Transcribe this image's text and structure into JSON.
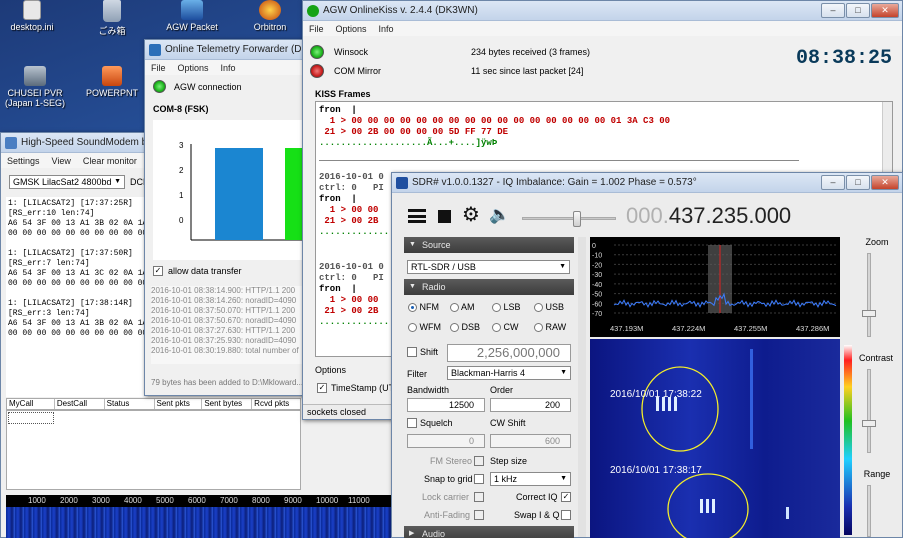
{
  "desktop": {
    "icons": [
      {
        "label": "desktop.ini",
        "icon": "file-icon"
      },
      {
        "label": "ごみ箱",
        "icon": "recycle-bin-icon"
      },
      {
        "label": "AGW Packet",
        "icon": "agw-icon"
      },
      {
        "label": "Orbitron",
        "icon": "orbitron-icon"
      },
      {
        "label": "CHUSEI PVR (Japan 1-SEG)",
        "icon": "tv-icon"
      },
      {
        "label": "POWERPNT",
        "icon": "powerpoint-icon"
      }
    ]
  },
  "soundmodem": {
    "title": "High-Speed SoundModem by...",
    "menu": [
      "Settings",
      "View",
      "Clear monitor"
    ],
    "mode": "GMSK LilacSat2 4800bd",
    "dcd": "DCD",
    "log": [
      "1: [LILACSAT2] [17:37:25R]",
      "[RS_err:10 len:74]",
      "A6 54 3F 00 13 A1 3B 02 0A 1A 00 00",
      "00 00 00 00 00 00 00 00 00 00 00 00",
      "",
      "1: [LILACSAT2] [17:37:50R]",
      "[RS_err:7 len:74]",
      "A6 54 3F 00 13 A1 3C 02 0A 1A 00 00",
      "00 00 00 00 00 00 00 00 00 00 00 00",
      "",
      "1: [LILACSAT2] [17:38:14R]",
      "[RS_err:3 len:74]",
      "A6 54 3F 00 13 A1 3B 02 0A 1A 00 00",
      "00 00 00 00 00 00 00 00 00 00 00 00"
    ],
    "table_headers": [
      "MyCall",
      "DestCall",
      "Status",
      "Sent pkts",
      "Sent bytes",
      "Rcvd pkts"
    ],
    "freq_ticks": [
      "1000",
      "2000",
      "3000",
      "4000",
      "5000",
      "6000",
      "7000",
      "8000",
      "9000",
      "10000",
      "11000"
    ]
  },
  "forwarder": {
    "title": "Online Telemetry Forwarder (D...",
    "menu": [
      "File",
      "Options",
      "Info"
    ],
    "agw_label": "AGW connection",
    "com_label": "COM-8 (FSK)",
    "bar_y_ticks": [
      "3",
      "2",
      "1",
      "0"
    ],
    "allow_label": "allow data transfer",
    "log": [
      "2016-10-01 08:38:14.900: HTTP/1.1 200",
      "2016-10-01 08:38:14.260: noradID=4090",
      "2016-10-01 08:37:50.070: HTTP/1.1 200",
      "2016-10-01 08:37:50.670: noradID=4090",
      "2016-10-01 08:37:27.630: HTTP/1.1 200",
      "2016-10-01 08:37:25.930: noradID=4090",
      "2016-10-01 08:30:19.880: total number of"
    ],
    "status": "79 bytes has been added to D:\\Mkloward..."
  },
  "agw": {
    "title": "AGW OnlineKiss  v. 2.4.4  (DK3WN)",
    "menu": [
      "File",
      "Options",
      "Info"
    ],
    "winsock_label": "Winsock",
    "winsock_status": "234 bytes received (3 frames)",
    "com_label": "COM Mirror",
    "com_status": "11 sec since last packet [24]",
    "clock": "08:38:25",
    "kiss_label": "KISS Frames",
    "frames_top": [
      {
        "text": "fron  |",
        "color": "#000"
      },
      {
        "text": "  1 > 00 00 00 00 00 00 00 00 00 00 00 00 00 00 00 00 01 3A C3 00",
        "color": "#c00000"
      },
      {
        "text": " 21 > 00 2B 00 00 00 00 5D FF 77 DE",
        "color": "#c00000"
      },
      {
        "text": "....................Ã...+....]ÿwÞ",
        "color": "#008000"
      }
    ],
    "frames_mid": [
      {
        "text": "2016-10-01 0",
        "color": "#555"
      },
      {
        "text": "ctrl: 0   PI",
        "color": "#555"
      },
      {
        "text": "fron  |",
        "color": "#000"
      },
      {
        "text": "  1 > 00 00",
        "color": "#c00000"
      },
      {
        "text": " 21 > 00 2B",
        "color": "#c00000"
      },
      {
        "text": "...............",
        "color": "#008000"
      }
    ],
    "frames_low": [
      {
        "text": "2016-10-01 0",
        "color": "#555"
      },
      {
        "text": "ctrl: 0   PI",
        "color": "#555"
      },
      {
        "text": "fron  |",
        "color": "#000"
      },
      {
        "text": "  1 > 00 00",
        "color": "#c00000"
      },
      {
        "text": " 21 > 00 2B",
        "color": "#c00000"
      },
      {
        "text": "...............",
        "color": "#008000"
      }
    ],
    "options_label": "Options",
    "timestamp_label": "TimeStamp (UTC)",
    "sockets_status": "sockets closed"
  },
  "sdr": {
    "title": "SDR# v1.0.0.1327 - IQ Imbalance: Gain = 1.002 Phase = 0.573°",
    "freq_dim": "000.",
    "freq_main": "437.235.000",
    "source_header": "Source",
    "source_value": "RTL-SDR / USB",
    "radio_header": "Radio",
    "modes_row1": [
      "NFM",
      "AM",
      "LSB",
      "USB"
    ],
    "modes_row2": [
      "WFM",
      "DSB",
      "CW",
      "RAW"
    ],
    "shift_label": "Shift",
    "shift_value": "2,256,000,000",
    "filter_label": "Filter",
    "filter_value": "Blackman-Harris 4",
    "bandwidth_label": "Bandwidth",
    "bandwidth_value": "12500",
    "order_label": "Order",
    "order_value": "200",
    "squelch_label": "Squelch",
    "squelch_value": "0",
    "cwshift_label": "CW Shift",
    "cwshift_value": "600",
    "fmstereo_label": "FM Stereo",
    "stepsize_label": "Step size",
    "snap_label": "Snap to grid",
    "snap_value": "1 kHz",
    "lockcarrier_label": "Lock carrier",
    "correctiq_label": "Correct IQ",
    "antifading_label": "Anti-Fading",
    "swapiq_label": "Swap I & Q",
    "audio_header": "Audio",
    "zoom_label": "Zoom",
    "contrast_label": "Contrast",
    "range_label": "Range",
    "spectrum_db": [
      "0",
      "-10",
      "-20",
      "-30",
      "-40",
      "-50",
      "-60",
      "-70"
    ],
    "spectrum_freqs": [
      "437.193M",
      "437.224M",
      "437.255M",
      "437.286M"
    ],
    "waterfall_stamps": [
      "2016/10/01 17:38:22",
      "2016/10/01 17:38:17"
    ]
  },
  "colors": {
    "led_green": "#1db31d",
    "led_red": "#c81e1e",
    "bar_blue": "#1b86d1",
    "bar_green": "#16e016",
    "kiss_red": "#c00000",
    "kiss_green": "#008000"
  }
}
